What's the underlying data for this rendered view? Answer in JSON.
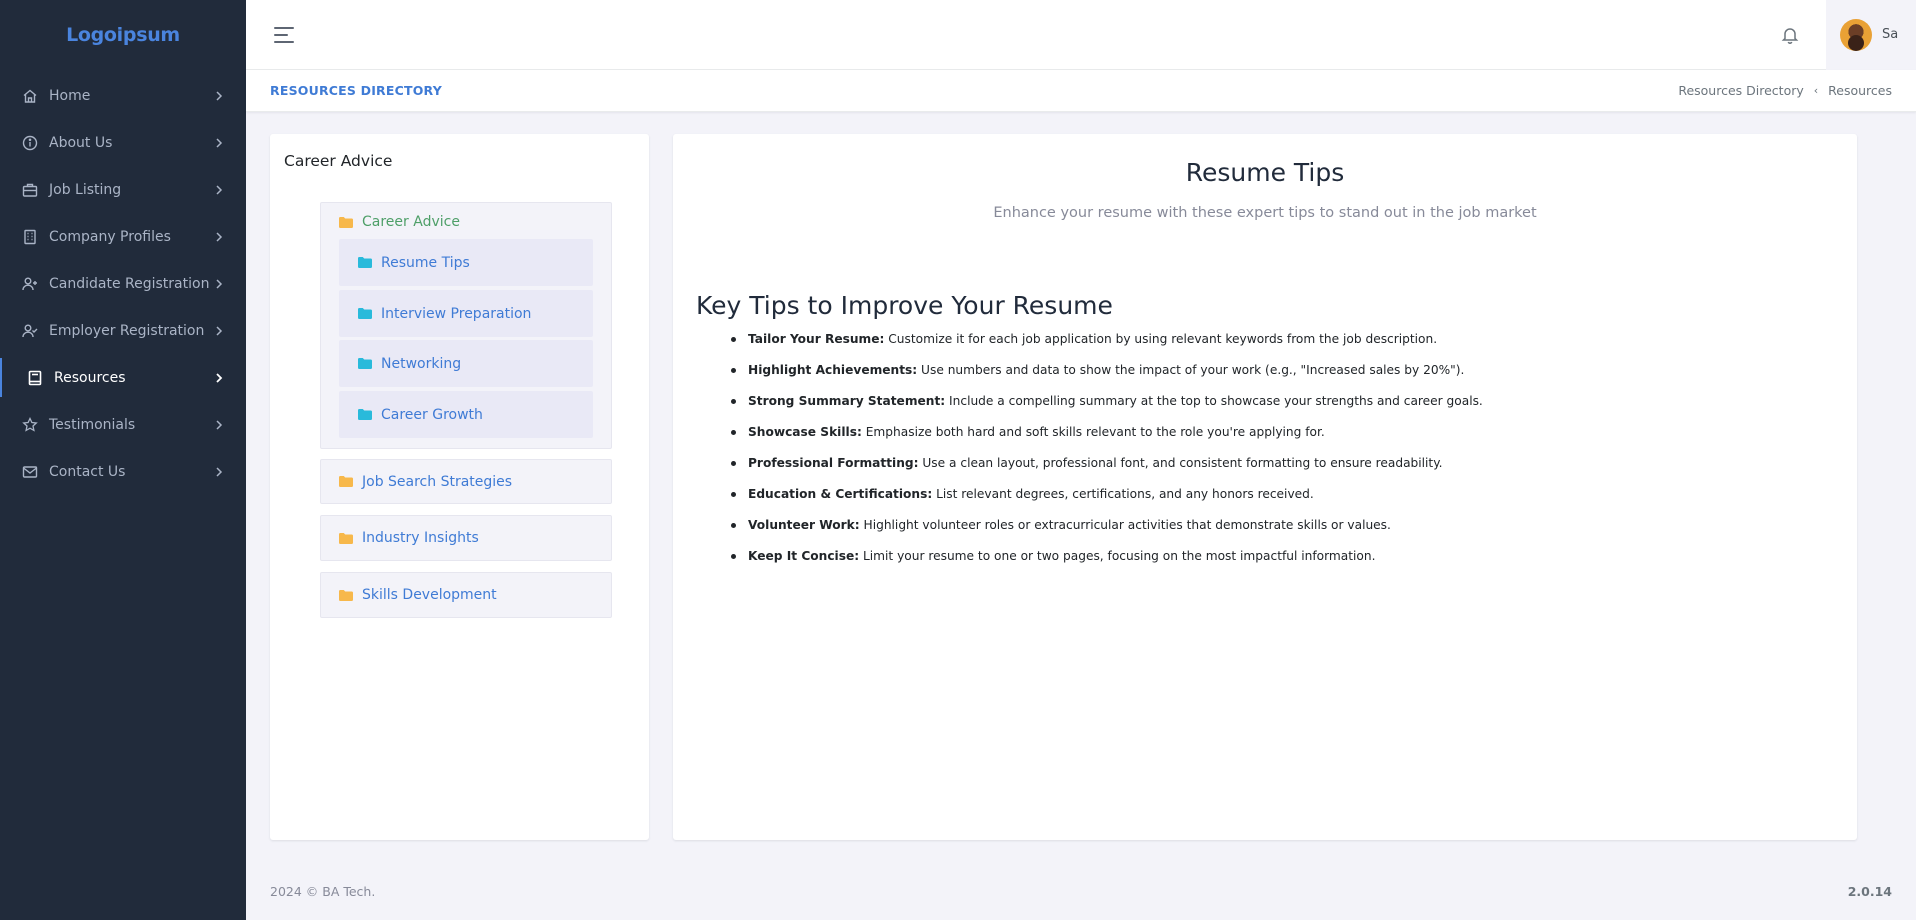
{
  "brand": {
    "logo_text": "Logoipsum",
    "accent": "#4a84de",
    "sidebar_bg": "#212b3b"
  },
  "sidebar": {
    "items": [
      {
        "label": "Home",
        "icon": "home-icon"
      },
      {
        "label": "About Us",
        "icon": "info-icon"
      },
      {
        "label": "Job Listing",
        "icon": "briefcase-icon"
      },
      {
        "label": "Company Profiles",
        "icon": "building-icon"
      },
      {
        "label": "Candidate Registration",
        "icon": "user-plus-icon"
      },
      {
        "label": "Employer Registration",
        "icon": "user-check-icon"
      },
      {
        "label": "Resources",
        "icon": "book-icon",
        "active": true
      },
      {
        "label": "Testimonials",
        "icon": "star-icon"
      },
      {
        "label": "Contact Us",
        "icon": "mail-icon"
      }
    ]
  },
  "header": {
    "user_name": "Sa"
  },
  "pagebar": {
    "title": "RESOURCES DIRECTORY",
    "breadcrumb": [
      "Resources Directory",
      "Resources"
    ]
  },
  "tree": {
    "card_title": "Career Advice",
    "group": {
      "label": "Career Advice",
      "children": [
        "Resume Tips",
        "Interview Preparation",
        "Networking",
        "Career Growth"
      ]
    },
    "folders": [
      "Job Search Strategies",
      "Industry Insights",
      "Skills Development"
    ]
  },
  "content": {
    "title": "Resume Tips",
    "subtitle": "Enhance your resume with these expert tips to stand out in the job market",
    "section_title": "Key Tips to Improve Your Resume",
    "tips": [
      {
        "label": "Tailor Your Resume:",
        "text": " Customize it for each job application by using relevant keywords from the job description."
      },
      {
        "label": "Highlight Achievements:",
        "text": " Use numbers and data to show the impact of your work (e.g., \"Increased sales by 20%\")."
      },
      {
        "label": "Strong Summary Statement:",
        "text": " Include a compelling summary at the top to showcase your strengths and career goals."
      },
      {
        "label": "Showcase Skills:",
        "text": " Emphasize both hard and soft skills relevant to the role you're applying for."
      },
      {
        "label": "Professional Formatting:",
        "text": " Use a clean layout, professional font, and consistent formatting to ensure readability."
      },
      {
        "label": "Education & Certifications:",
        "text": " List relevant degrees, certifications, and any honors received."
      },
      {
        "label": "Volunteer Work:",
        "text": " Highlight volunteer roles or extracurricular activities that demonstrate skills or values."
      },
      {
        "label": "Keep It Concise:",
        "text": " Limit your resume to one or two pages, focusing on the most impactful information."
      }
    ]
  },
  "footer": {
    "copyright": "2024 © BA Tech.",
    "version": "2.0.14"
  },
  "colors": {
    "folder_yellow": "#f7b84b",
    "folder_blue": "#29badb",
    "link_blue": "#3f7bd5",
    "open_green": "#4e9f68"
  }
}
